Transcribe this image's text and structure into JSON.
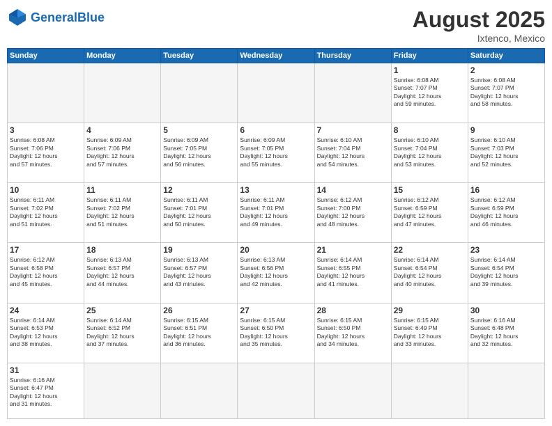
{
  "header": {
    "logo_general": "General",
    "logo_blue": "Blue",
    "month_title": "August 2025",
    "location": "Ixtenco, Mexico"
  },
  "weekdays": [
    "Sunday",
    "Monday",
    "Tuesday",
    "Wednesday",
    "Thursday",
    "Friday",
    "Saturday"
  ],
  "weeks": [
    [
      {
        "day": "",
        "info": ""
      },
      {
        "day": "",
        "info": ""
      },
      {
        "day": "",
        "info": ""
      },
      {
        "day": "",
        "info": ""
      },
      {
        "day": "",
        "info": ""
      },
      {
        "day": "1",
        "info": "Sunrise: 6:08 AM\nSunset: 7:07 PM\nDaylight: 12 hours\nand 59 minutes."
      },
      {
        "day": "2",
        "info": "Sunrise: 6:08 AM\nSunset: 7:07 PM\nDaylight: 12 hours\nand 58 minutes."
      }
    ],
    [
      {
        "day": "3",
        "info": "Sunrise: 6:08 AM\nSunset: 7:06 PM\nDaylight: 12 hours\nand 57 minutes."
      },
      {
        "day": "4",
        "info": "Sunrise: 6:09 AM\nSunset: 7:06 PM\nDaylight: 12 hours\nand 57 minutes."
      },
      {
        "day": "5",
        "info": "Sunrise: 6:09 AM\nSunset: 7:05 PM\nDaylight: 12 hours\nand 56 minutes."
      },
      {
        "day": "6",
        "info": "Sunrise: 6:09 AM\nSunset: 7:05 PM\nDaylight: 12 hours\nand 55 minutes."
      },
      {
        "day": "7",
        "info": "Sunrise: 6:10 AM\nSunset: 7:04 PM\nDaylight: 12 hours\nand 54 minutes."
      },
      {
        "day": "8",
        "info": "Sunrise: 6:10 AM\nSunset: 7:04 PM\nDaylight: 12 hours\nand 53 minutes."
      },
      {
        "day": "9",
        "info": "Sunrise: 6:10 AM\nSunset: 7:03 PM\nDaylight: 12 hours\nand 52 minutes."
      }
    ],
    [
      {
        "day": "10",
        "info": "Sunrise: 6:11 AM\nSunset: 7:02 PM\nDaylight: 12 hours\nand 51 minutes."
      },
      {
        "day": "11",
        "info": "Sunrise: 6:11 AM\nSunset: 7:02 PM\nDaylight: 12 hours\nand 51 minutes."
      },
      {
        "day": "12",
        "info": "Sunrise: 6:11 AM\nSunset: 7:01 PM\nDaylight: 12 hours\nand 50 minutes."
      },
      {
        "day": "13",
        "info": "Sunrise: 6:11 AM\nSunset: 7:01 PM\nDaylight: 12 hours\nand 49 minutes."
      },
      {
        "day": "14",
        "info": "Sunrise: 6:12 AM\nSunset: 7:00 PM\nDaylight: 12 hours\nand 48 minutes."
      },
      {
        "day": "15",
        "info": "Sunrise: 6:12 AM\nSunset: 6:59 PM\nDaylight: 12 hours\nand 47 minutes."
      },
      {
        "day": "16",
        "info": "Sunrise: 6:12 AM\nSunset: 6:59 PM\nDaylight: 12 hours\nand 46 minutes."
      }
    ],
    [
      {
        "day": "17",
        "info": "Sunrise: 6:12 AM\nSunset: 6:58 PM\nDaylight: 12 hours\nand 45 minutes."
      },
      {
        "day": "18",
        "info": "Sunrise: 6:13 AM\nSunset: 6:57 PM\nDaylight: 12 hours\nand 44 minutes."
      },
      {
        "day": "19",
        "info": "Sunrise: 6:13 AM\nSunset: 6:57 PM\nDaylight: 12 hours\nand 43 minutes."
      },
      {
        "day": "20",
        "info": "Sunrise: 6:13 AM\nSunset: 6:56 PM\nDaylight: 12 hours\nand 42 minutes."
      },
      {
        "day": "21",
        "info": "Sunrise: 6:14 AM\nSunset: 6:55 PM\nDaylight: 12 hours\nand 41 minutes."
      },
      {
        "day": "22",
        "info": "Sunrise: 6:14 AM\nSunset: 6:54 PM\nDaylight: 12 hours\nand 40 minutes."
      },
      {
        "day": "23",
        "info": "Sunrise: 6:14 AM\nSunset: 6:54 PM\nDaylight: 12 hours\nand 39 minutes."
      }
    ],
    [
      {
        "day": "24",
        "info": "Sunrise: 6:14 AM\nSunset: 6:53 PM\nDaylight: 12 hours\nand 38 minutes."
      },
      {
        "day": "25",
        "info": "Sunrise: 6:14 AM\nSunset: 6:52 PM\nDaylight: 12 hours\nand 37 minutes."
      },
      {
        "day": "26",
        "info": "Sunrise: 6:15 AM\nSunset: 6:51 PM\nDaylight: 12 hours\nand 36 minutes."
      },
      {
        "day": "27",
        "info": "Sunrise: 6:15 AM\nSunset: 6:50 PM\nDaylight: 12 hours\nand 35 minutes."
      },
      {
        "day": "28",
        "info": "Sunrise: 6:15 AM\nSunset: 6:50 PM\nDaylight: 12 hours\nand 34 minutes."
      },
      {
        "day": "29",
        "info": "Sunrise: 6:15 AM\nSunset: 6:49 PM\nDaylight: 12 hours\nand 33 minutes."
      },
      {
        "day": "30",
        "info": "Sunrise: 6:16 AM\nSunset: 6:48 PM\nDaylight: 12 hours\nand 32 minutes."
      }
    ],
    [
      {
        "day": "31",
        "info": "Sunrise: 6:16 AM\nSunset: 6:47 PM\nDaylight: 12 hours\nand 31 minutes."
      },
      {
        "day": "",
        "info": ""
      },
      {
        "day": "",
        "info": ""
      },
      {
        "day": "",
        "info": ""
      },
      {
        "day": "",
        "info": ""
      },
      {
        "day": "",
        "info": ""
      },
      {
        "day": "",
        "info": ""
      }
    ]
  ]
}
